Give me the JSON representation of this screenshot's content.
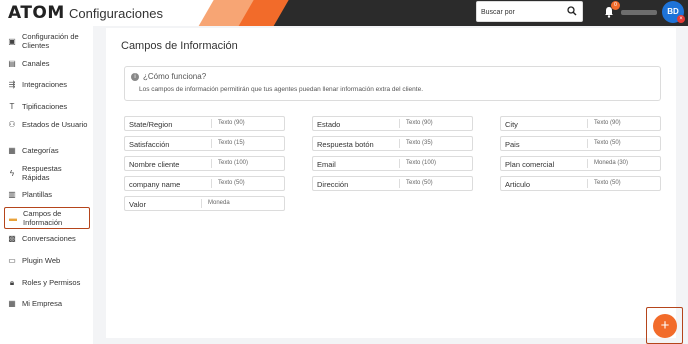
{
  "header": {
    "logo": "ATOM",
    "app_title": "Configuraciones",
    "search_placeholder": "Buscar por",
    "notifications_count": "0",
    "avatar_initials": "BD"
  },
  "sidebar": {
    "items": [
      {
        "label": "Configuración de Clientes",
        "icon": "id-card-icon"
      },
      {
        "label": "Canales",
        "icon": "chat-icon"
      },
      {
        "label": "Integraciones",
        "icon": "integrations-icon"
      },
      {
        "label": "Tipificaciones",
        "icon": "text-t-icon"
      },
      {
        "label": "Estados de Usuario",
        "icon": "user-status-icon"
      },
      {
        "label": "Categorías",
        "icon": "folder-icon"
      },
      {
        "label": "Respuestas Rápidas",
        "icon": "bolt-icon"
      },
      {
        "label": "Plantillas",
        "icon": "template-icon"
      },
      {
        "label": "Campos de Información",
        "icon": "info-card-icon"
      },
      {
        "label": "Conversaciones",
        "icon": "conversation-icon"
      },
      {
        "label": "Plugin Web",
        "icon": "plugin-icon"
      },
      {
        "label": "Roles y Permisos",
        "icon": "lock-icon"
      },
      {
        "label": "Mi Empresa",
        "icon": "company-icon"
      }
    ]
  },
  "main": {
    "title": "Campos de Información",
    "info": {
      "heading": "¿Cómo funciona?",
      "body": "Los campos de información permitirán que tus agentes puedan llenar información extra del cliente."
    },
    "fields": [
      {
        "name": "State/Region",
        "type": "Texto (90)"
      },
      {
        "name": "Estado",
        "type": "Texto (90)"
      },
      {
        "name": "City",
        "type": "Texto (90)"
      },
      {
        "name": "Satisfacción",
        "type": "Texto (15)"
      },
      {
        "name": "Respuesta botón",
        "type": "Texto (35)"
      },
      {
        "name": "Pais",
        "type": "Texto (50)"
      },
      {
        "name": "Nombre cliente",
        "type": "Texto (100)"
      },
      {
        "name": "Email",
        "type": "Texto (100)"
      },
      {
        "name": "Plan comercial",
        "type": "Moneda (30)"
      },
      {
        "name": "company name",
        "type": "Texto (50)"
      },
      {
        "name": "Dirección",
        "type": "Texto (50)"
      },
      {
        "name": "Articulo",
        "type": "Texto (50)"
      },
      {
        "name": "Valor",
        "type": "Moneda"
      }
    ]
  },
  "fab": {
    "label": "+"
  },
  "colors": {
    "accent": "#f26b2a",
    "dark": "#2b2b2b",
    "avatar": "#1e73d8",
    "highlight_border": "#b5451b"
  }
}
